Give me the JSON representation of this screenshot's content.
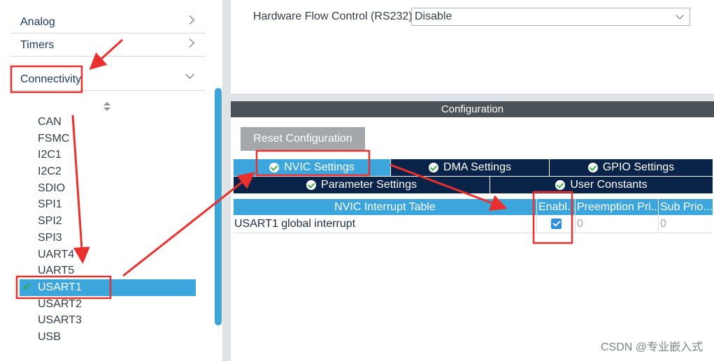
{
  "sidebar": {
    "categories": [
      {
        "label": "Analog",
        "state": "collapsed"
      },
      {
        "label": "Timers",
        "state": "collapsed"
      },
      {
        "label": "Connectivity",
        "state": "expanded"
      }
    ],
    "peripherals": [
      {
        "label": "CAN"
      },
      {
        "label": "FSMC"
      },
      {
        "label": "I2C1"
      },
      {
        "label": "I2C2"
      },
      {
        "label": "SDIO"
      },
      {
        "label": "SPI1"
      },
      {
        "label": "SPI2"
      },
      {
        "label": "SPI3"
      },
      {
        "label": "UART4"
      },
      {
        "label": "UART5"
      },
      {
        "label": "USART1",
        "selected": true,
        "check": "✔"
      },
      {
        "label": "USART2"
      },
      {
        "label": "USART3"
      },
      {
        "label": "USB"
      }
    ]
  },
  "mode": {
    "flow_control_label": "Hardware Flow Control (RS232)",
    "flow_control_value": "Disable"
  },
  "configuration": {
    "header": "Configuration",
    "reset_label": "Reset Configuration",
    "tabs_row1": [
      {
        "label": "NVIC Settings",
        "active": true
      },
      {
        "label": "DMA Settings"
      },
      {
        "label": "GPIO Settings"
      }
    ],
    "tabs_row2": [
      {
        "label": "Parameter Settings"
      },
      {
        "label": "User Constants"
      }
    ],
    "nvic_table": {
      "columns": [
        "NVIC Interrupt Table",
        "Enabl...",
        "Preemption Pri...",
        "Sub Prio..."
      ],
      "rows": [
        {
          "name": "USART1 global interrupt",
          "enabled": true,
          "preemption": "0",
          "sub": "0"
        }
      ]
    }
  },
  "watermark": "CSDN @专业嵌入式",
  "colors": {
    "accent": "#3ba5dc",
    "tab_dark": "#0a2348",
    "header_dark": "#4b5258",
    "annotation_red": "#e8312f",
    "check_green": "#2fa84f"
  }
}
